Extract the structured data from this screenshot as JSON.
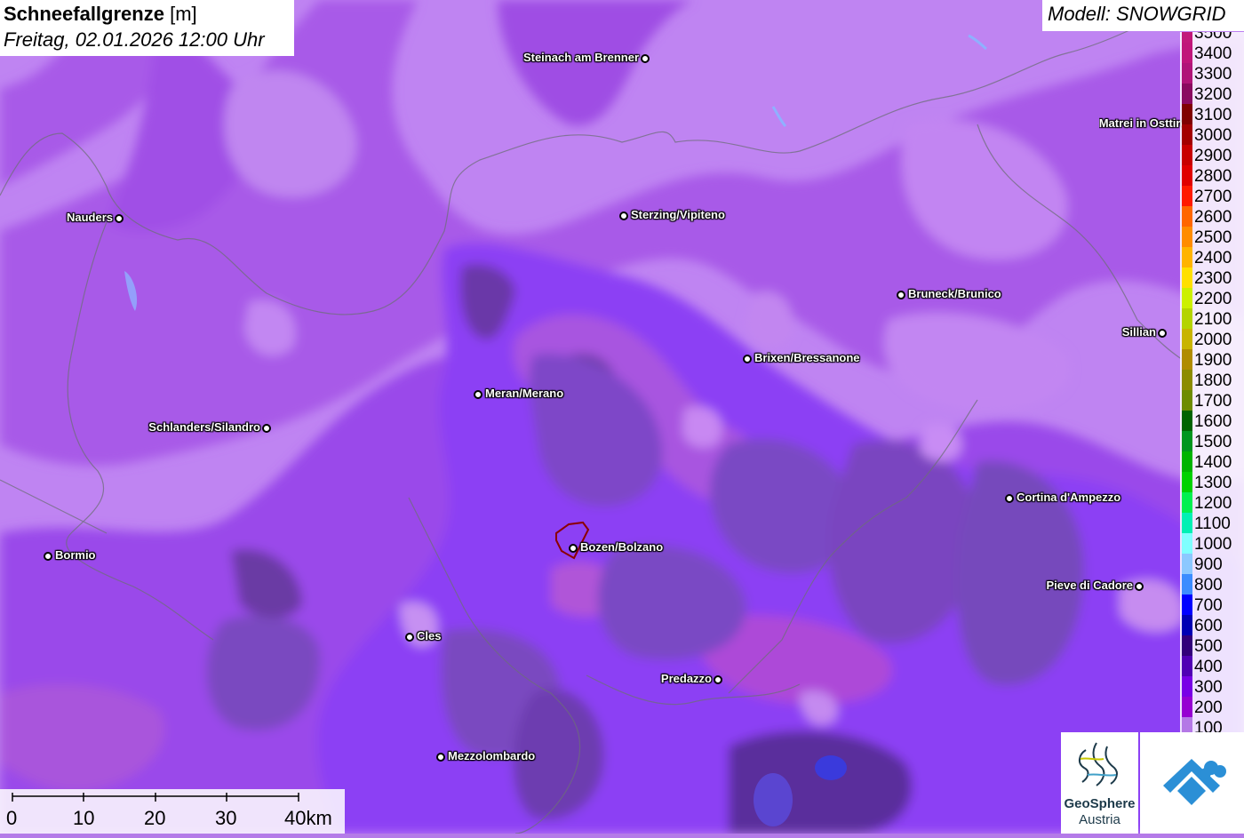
{
  "header": {
    "title": "Schneefallgrenze",
    "unit": "[m]",
    "date": "Freitag, 02.01.2026 12:00 Uhr",
    "model": "Modell: SNOWGRID"
  },
  "places": [
    {
      "id": "steinach",
      "name": "Steinach am Brenner"
    },
    {
      "id": "nauders",
      "name": "Nauders"
    },
    {
      "id": "sterzing",
      "name": "Sterzing/Vipiteno"
    },
    {
      "id": "matrei",
      "name": "Matrei in Osttirol"
    },
    {
      "id": "bruneck",
      "name": "Bruneck/Brunico"
    },
    {
      "id": "sillian",
      "name": "Sillian"
    },
    {
      "id": "brixen",
      "name": "Brixen/Bressanone"
    },
    {
      "id": "meran",
      "name": "Meran/Merano"
    },
    {
      "id": "schlanders",
      "name": "Schlanders/Silandro"
    },
    {
      "id": "cortina",
      "name": "Cortina d'Ampezzo"
    },
    {
      "id": "bormio",
      "name": "Bormio"
    },
    {
      "id": "bozen",
      "name": "Bozen/Bolzano"
    },
    {
      "id": "pieve",
      "name": "Pieve di Cadore"
    },
    {
      "id": "cles",
      "name": "Cles"
    },
    {
      "id": "predazzo",
      "name": "Predazzo"
    },
    {
      "id": "mezzolombardo",
      "name": "Mezzolombardo"
    }
  ],
  "legend": [
    {
      "v": "3500",
      "c": "#c2187a"
    },
    {
      "v": "3400",
      "c": "#c0157a"
    },
    {
      "v": "3300",
      "c": "#b01478"
    },
    {
      "v": "3200",
      "c": "#8a0a60"
    },
    {
      "v": "3100",
      "c": "#800000"
    },
    {
      "v": "3000",
      "c": "#a30000"
    },
    {
      "v": "2900",
      "c": "#c80000"
    },
    {
      "v": "2800",
      "c": "#e00000"
    },
    {
      "v": "2700",
      "c": "#ff1a00"
    },
    {
      "v": "2600",
      "c": "#ff6600"
    },
    {
      "v": "2500",
      "c": "#ff8c00"
    },
    {
      "v": "2400",
      "c": "#ffb400"
    },
    {
      "v": "2300",
      "c": "#ffe000"
    },
    {
      "v": "2200",
      "c": "#ccf000"
    },
    {
      "v": "2100",
      "c": "#b4d400"
    },
    {
      "v": "2000",
      "c": "#c8b400"
    },
    {
      "v": "1900",
      "c": "#b08c00"
    },
    {
      "v": "1800",
      "c": "#8c8c00"
    },
    {
      "v": "1700",
      "c": "#6e8c00"
    },
    {
      "v": "1600",
      "c": "#006400"
    },
    {
      "v": "1500",
      "c": "#00961e"
    },
    {
      "v": "1400",
      "c": "#00b400"
    },
    {
      "v": "1300",
      "c": "#00d200"
    },
    {
      "v": "1200",
      "c": "#00f050"
    },
    {
      "v": "1100",
      "c": "#00f0b4"
    },
    {
      "v": "1000",
      "c": "#80ffff"
    },
    {
      "v": "900",
      "c": "#8cc8ff"
    },
    {
      "v": "800",
      "c": "#3c8cff"
    },
    {
      "v": "700",
      "c": "#0000ff"
    },
    {
      "v": "600",
      "c": "#0000b4"
    },
    {
      "v": "500",
      "c": "#32007a"
    },
    {
      "v": "400",
      "c": "#5000b4"
    },
    {
      "v": "300",
      "c": "#7800e6"
    },
    {
      "v": "200",
      "c": "#9600d2"
    },
    {
      "v": "100",
      "c": "#b478e6"
    }
  ],
  "scale": {
    "labels": [
      "0",
      "10",
      "20",
      "30",
      "40km"
    ]
  },
  "logos": {
    "geo_line1": "GeoSphere",
    "geo_line2": "Austria"
  },
  "colors": {
    "light": "#be82f0",
    "mid": "#a855e8",
    "deep": "#8b3cf0",
    "dark": "#6a3aa8",
    "magenta": "#b04ad8"
  }
}
